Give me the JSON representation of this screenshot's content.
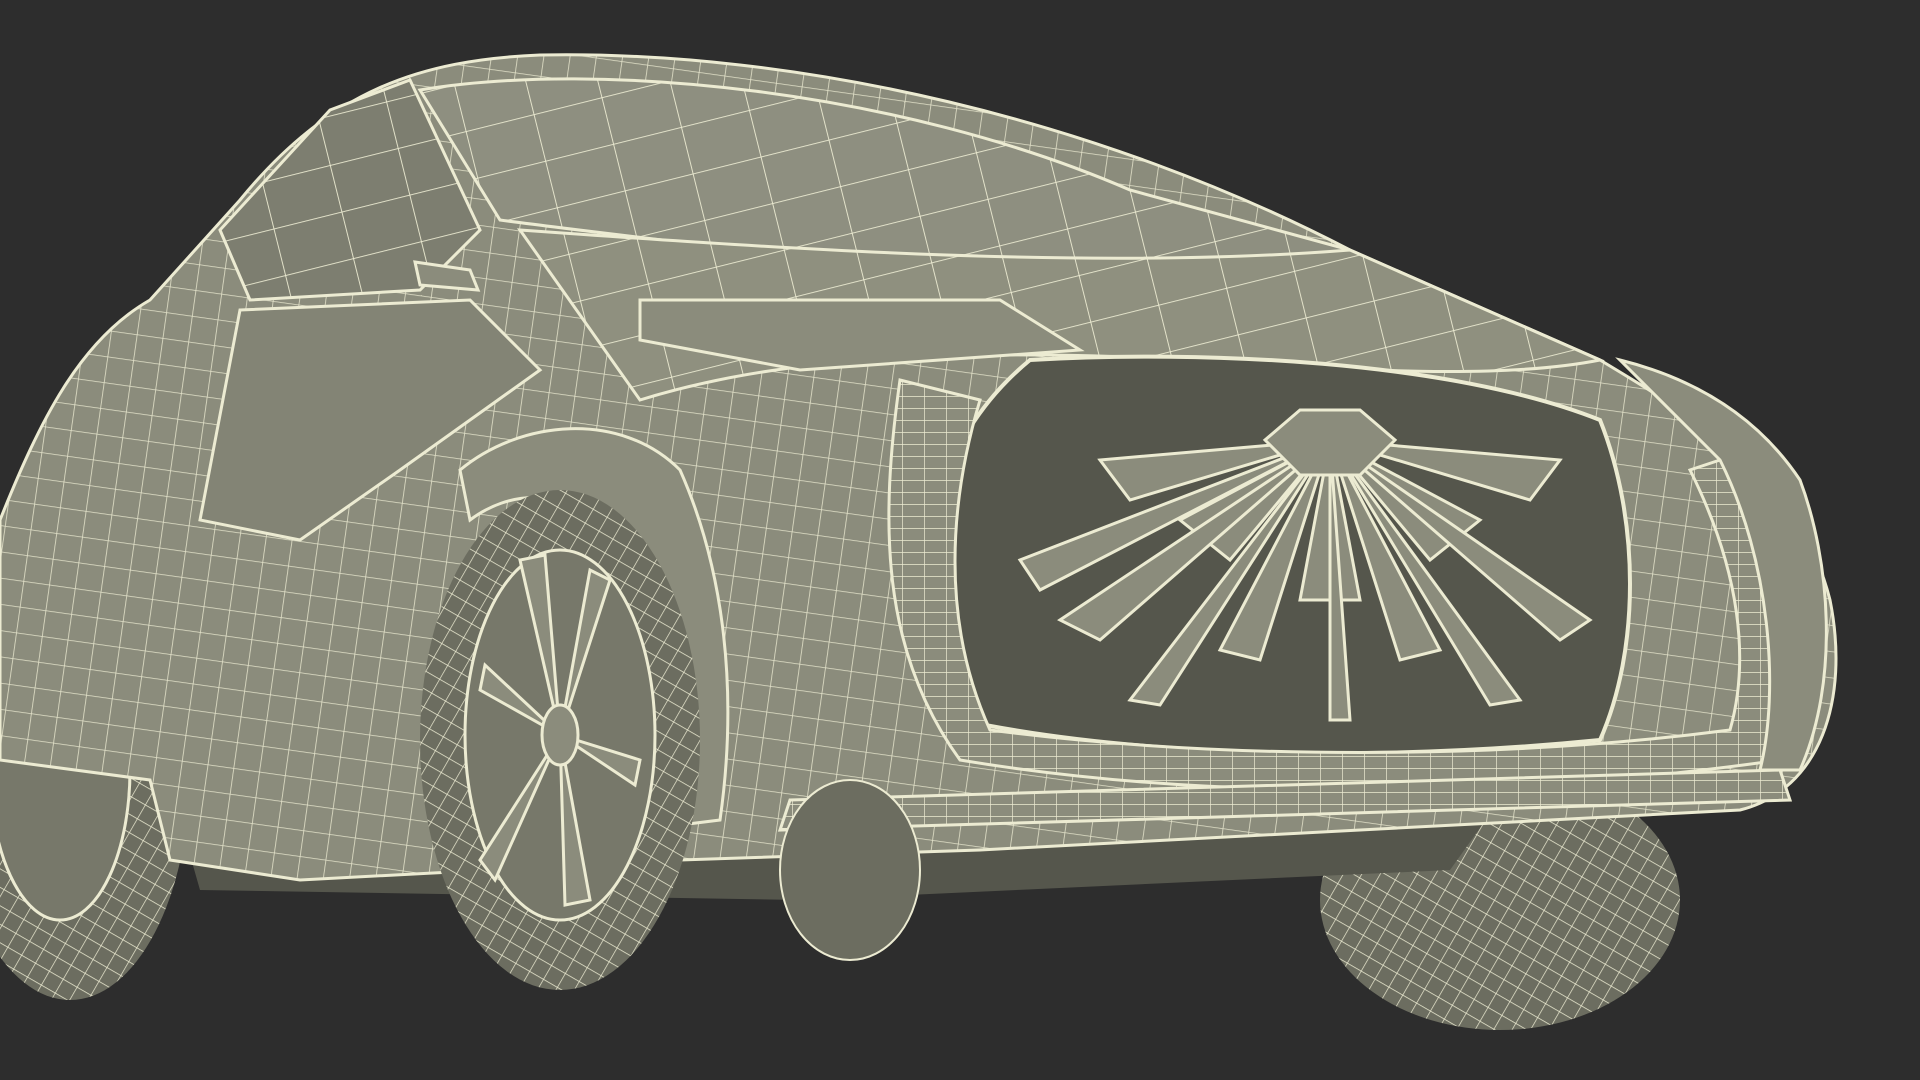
{
  "scene": {
    "subject": "car-wireframe-render",
    "colors": {
      "background": "#2d2d2d",
      "surface": "#8b8c7c",
      "surface_shade": "#6c6d60",
      "surface_dark": "#55564c",
      "wire": "#ecebd2"
    }
  }
}
